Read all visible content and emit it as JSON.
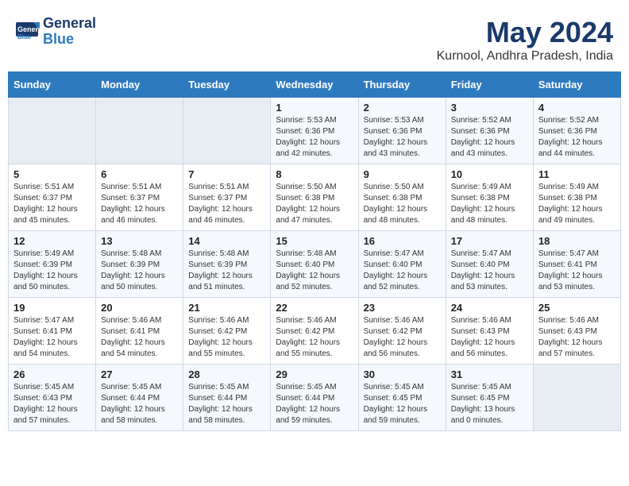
{
  "header": {
    "logo_line1": "General",
    "logo_line2": "Blue",
    "title": "May 2024",
    "subtitle": "Kurnool, Andhra Pradesh, India"
  },
  "days_of_week": [
    "Sunday",
    "Monday",
    "Tuesday",
    "Wednesday",
    "Thursday",
    "Friday",
    "Saturday"
  ],
  "weeks": [
    [
      {
        "num": "",
        "content": ""
      },
      {
        "num": "",
        "content": ""
      },
      {
        "num": "",
        "content": ""
      },
      {
        "num": "1",
        "content": "Sunrise: 5:53 AM\nSunset: 6:36 PM\nDaylight: 12 hours\nand 42 minutes."
      },
      {
        "num": "2",
        "content": "Sunrise: 5:53 AM\nSunset: 6:36 PM\nDaylight: 12 hours\nand 43 minutes."
      },
      {
        "num": "3",
        "content": "Sunrise: 5:52 AM\nSunset: 6:36 PM\nDaylight: 12 hours\nand 43 minutes."
      },
      {
        "num": "4",
        "content": "Sunrise: 5:52 AM\nSunset: 6:36 PM\nDaylight: 12 hours\nand 44 minutes."
      }
    ],
    [
      {
        "num": "5",
        "content": "Sunrise: 5:51 AM\nSunset: 6:37 PM\nDaylight: 12 hours\nand 45 minutes."
      },
      {
        "num": "6",
        "content": "Sunrise: 5:51 AM\nSunset: 6:37 PM\nDaylight: 12 hours\nand 46 minutes."
      },
      {
        "num": "7",
        "content": "Sunrise: 5:51 AM\nSunset: 6:37 PM\nDaylight: 12 hours\nand 46 minutes."
      },
      {
        "num": "8",
        "content": "Sunrise: 5:50 AM\nSunset: 6:38 PM\nDaylight: 12 hours\nand 47 minutes."
      },
      {
        "num": "9",
        "content": "Sunrise: 5:50 AM\nSunset: 6:38 PM\nDaylight: 12 hours\nand 48 minutes."
      },
      {
        "num": "10",
        "content": "Sunrise: 5:49 AM\nSunset: 6:38 PM\nDaylight: 12 hours\nand 48 minutes."
      },
      {
        "num": "11",
        "content": "Sunrise: 5:49 AM\nSunset: 6:38 PM\nDaylight: 12 hours\nand 49 minutes."
      }
    ],
    [
      {
        "num": "12",
        "content": "Sunrise: 5:49 AM\nSunset: 6:39 PM\nDaylight: 12 hours\nand 50 minutes."
      },
      {
        "num": "13",
        "content": "Sunrise: 5:48 AM\nSunset: 6:39 PM\nDaylight: 12 hours\nand 50 minutes."
      },
      {
        "num": "14",
        "content": "Sunrise: 5:48 AM\nSunset: 6:39 PM\nDaylight: 12 hours\nand 51 minutes."
      },
      {
        "num": "15",
        "content": "Sunrise: 5:48 AM\nSunset: 6:40 PM\nDaylight: 12 hours\nand 52 minutes."
      },
      {
        "num": "16",
        "content": "Sunrise: 5:47 AM\nSunset: 6:40 PM\nDaylight: 12 hours\nand 52 minutes."
      },
      {
        "num": "17",
        "content": "Sunrise: 5:47 AM\nSunset: 6:40 PM\nDaylight: 12 hours\nand 53 minutes."
      },
      {
        "num": "18",
        "content": "Sunrise: 5:47 AM\nSunset: 6:41 PM\nDaylight: 12 hours\nand 53 minutes."
      }
    ],
    [
      {
        "num": "19",
        "content": "Sunrise: 5:47 AM\nSunset: 6:41 PM\nDaylight: 12 hours\nand 54 minutes."
      },
      {
        "num": "20",
        "content": "Sunrise: 5:46 AM\nSunset: 6:41 PM\nDaylight: 12 hours\nand 54 minutes."
      },
      {
        "num": "21",
        "content": "Sunrise: 5:46 AM\nSunset: 6:42 PM\nDaylight: 12 hours\nand 55 minutes."
      },
      {
        "num": "22",
        "content": "Sunrise: 5:46 AM\nSunset: 6:42 PM\nDaylight: 12 hours\nand 55 minutes."
      },
      {
        "num": "23",
        "content": "Sunrise: 5:46 AM\nSunset: 6:42 PM\nDaylight: 12 hours\nand 56 minutes."
      },
      {
        "num": "24",
        "content": "Sunrise: 5:46 AM\nSunset: 6:43 PM\nDaylight: 12 hours\nand 56 minutes."
      },
      {
        "num": "25",
        "content": "Sunrise: 5:46 AM\nSunset: 6:43 PM\nDaylight: 12 hours\nand 57 minutes."
      }
    ],
    [
      {
        "num": "26",
        "content": "Sunrise: 5:45 AM\nSunset: 6:43 PM\nDaylight: 12 hours\nand 57 minutes."
      },
      {
        "num": "27",
        "content": "Sunrise: 5:45 AM\nSunset: 6:44 PM\nDaylight: 12 hours\nand 58 minutes."
      },
      {
        "num": "28",
        "content": "Sunrise: 5:45 AM\nSunset: 6:44 PM\nDaylight: 12 hours\nand 58 minutes."
      },
      {
        "num": "29",
        "content": "Sunrise: 5:45 AM\nSunset: 6:44 PM\nDaylight: 12 hours\nand 59 minutes."
      },
      {
        "num": "30",
        "content": "Sunrise: 5:45 AM\nSunset: 6:45 PM\nDaylight: 12 hours\nand 59 minutes."
      },
      {
        "num": "31",
        "content": "Sunrise: 5:45 AM\nSunset: 6:45 PM\nDaylight: 13 hours\nand 0 minutes."
      },
      {
        "num": "",
        "content": ""
      }
    ]
  ]
}
